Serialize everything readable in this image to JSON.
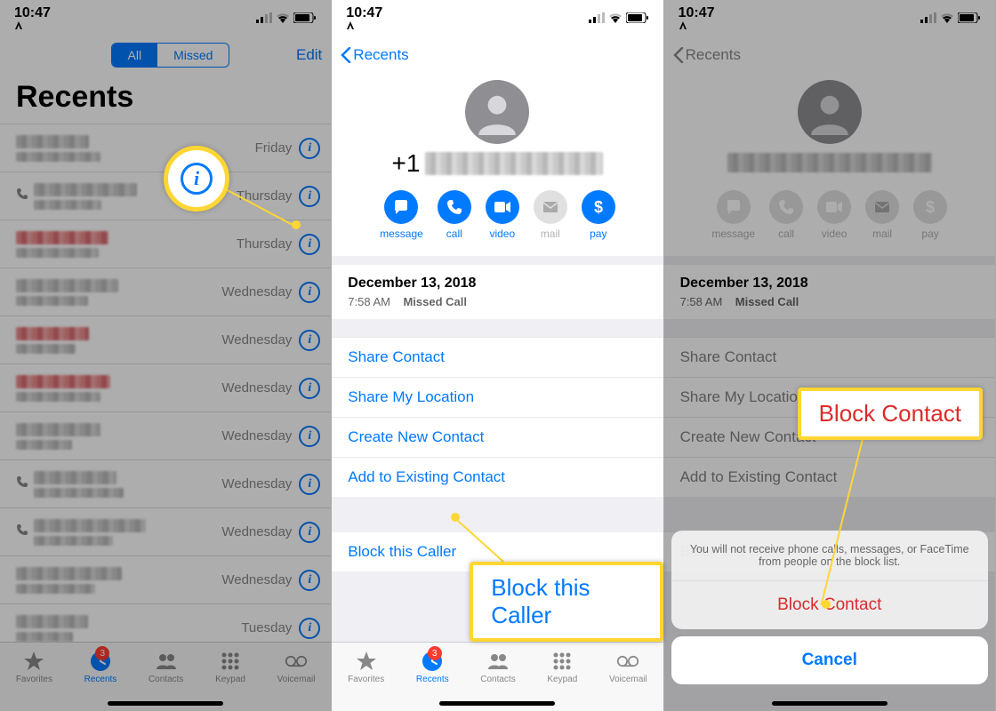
{
  "status": {
    "time": "10:47",
    "signal": 2,
    "wifi": 2
  },
  "screen1": {
    "seg_all": "All",
    "seg_missed": "Missed",
    "edit": "Edit",
    "title": "Recents",
    "rows": [
      {
        "day": "Friday",
        "red": false,
        "icon": false
      },
      {
        "day": "Thursday",
        "red": false,
        "icon": true
      },
      {
        "day": "Thursday",
        "red": true,
        "icon": false
      },
      {
        "day": "Wednesday",
        "red": false,
        "icon": false
      },
      {
        "day": "Wednesday",
        "red": true,
        "icon": false
      },
      {
        "day": "Wednesday",
        "red": true,
        "icon": false
      },
      {
        "day": "Wednesday",
        "red": false,
        "icon": false
      },
      {
        "day": "Wednesday",
        "red": false,
        "icon": true
      },
      {
        "day": "Wednesday",
        "red": false,
        "icon": true
      },
      {
        "day": "Wednesday",
        "red": false,
        "icon": false
      },
      {
        "day": "Tuesday",
        "red": false,
        "icon": false
      }
    ]
  },
  "tabs": [
    {
      "label": "Favorites",
      "sel": false,
      "badge": null
    },
    {
      "label": "Recents",
      "sel": true,
      "badge": "3"
    },
    {
      "label": "Contacts",
      "sel": false,
      "badge": null
    },
    {
      "label": "Keypad",
      "sel": false,
      "badge": null
    },
    {
      "label": "Voicemail",
      "sel": false,
      "badge": null
    }
  ],
  "screen2": {
    "back": "Recents",
    "prefix": "+1",
    "date": "December 13, 2018",
    "time": "7:58 AM",
    "status": "Missed Call",
    "share_contact": "Share Contact",
    "share_loc": "Share My Location",
    "create": "Create New Contact",
    "add": "Add to Existing Contact",
    "block": "Block this Caller",
    "actions": [
      {
        "id": "message",
        "label": "message",
        "en": true
      },
      {
        "id": "call",
        "label": "call",
        "en": true
      },
      {
        "id": "video",
        "label": "video",
        "en": true
      },
      {
        "id": "mail",
        "label": "mail",
        "en": false
      },
      {
        "id": "pay",
        "label": "pay",
        "en": true
      }
    ]
  },
  "screen3": {
    "sheet_msg": "You will not receive phone calls, messages, or FaceTime from people on the block list.",
    "sheet_block": "Block Contact",
    "sheet_cancel": "Cancel"
  },
  "callouts": {
    "c2": "Block this Caller",
    "c3": "Block Contact"
  }
}
